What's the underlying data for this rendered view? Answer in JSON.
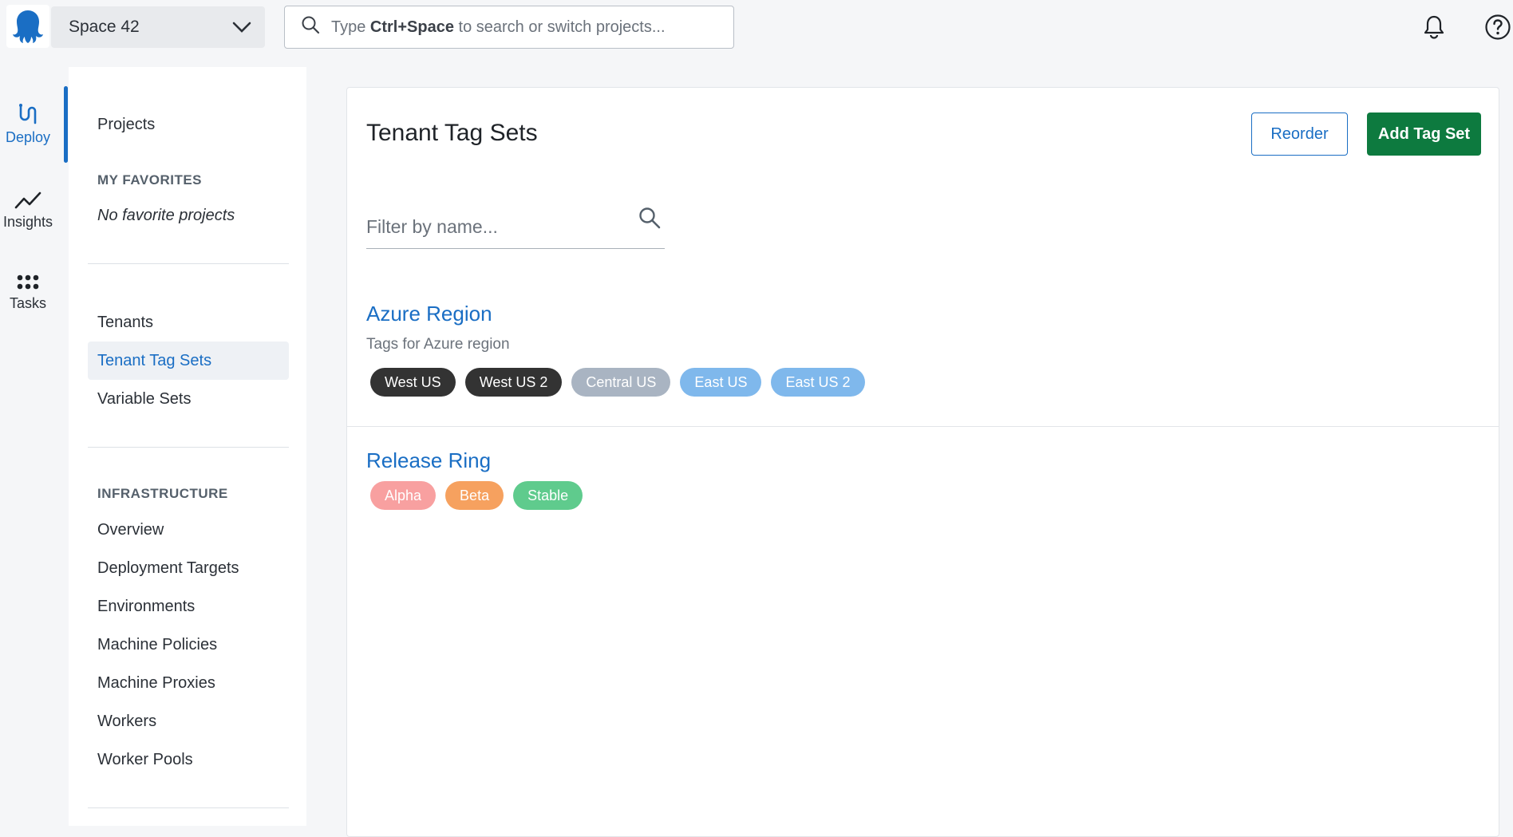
{
  "header": {
    "space_name": "Space 42",
    "search_prefix": "Type ",
    "search_shortcut": "Ctrl+Space",
    "search_suffix": " to search or switch projects..."
  },
  "rail": {
    "items": [
      {
        "label": "Deploy",
        "icon": "deploy-icon"
      },
      {
        "label": "Insights",
        "icon": "trend-icon"
      },
      {
        "label": "Tasks",
        "icon": "dots-grid-icon"
      }
    ]
  },
  "sidenav": {
    "projects": "Projects",
    "favorites_header": "MY FAVORITES",
    "favorites_empty": "No favorite projects",
    "library": [
      "Tenants",
      "Tenant Tag Sets",
      "Variable Sets"
    ],
    "infrastructure_header": "INFRASTRUCTURE",
    "infrastructure": [
      "Overview",
      "Deployment Targets",
      "Environments",
      "Machine Policies",
      "Machine Proxies",
      "Workers",
      "Worker Pools"
    ]
  },
  "main": {
    "title": "Tenant Tag Sets",
    "reorder_label": "Reorder",
    "add_label": "Add Tag Set",
    "filter_placeholder": "Filter by name...",
    "tag_sets": [
      {
        "name": "Azure Region",
        "description": "Tags for Azure region",
        "tags": [
          {
            "label": "West US",
            "color": "#333333"
          },
          {
            "label": "West US 2",
            "color": "#333333"
          },
          {
            "label": "Central US",
            "color": "#a9b4c2"
          },
          {
            "label": "East US",
            "color": "#7fb8ec"
          },
          {
            "label": "East US 2",
            "color": "#7fb8ec"
          }
        ]
      },
      {
        "name": "Release Ring",
        "description": "",
        "tags": [
          {
            "label": "Alpha",
            "color": "#f8a0a0"
          },
          {
            "label": "Beta",
            "color": "#f6a15f"
          },
          {
            "label": "Stable",
            "color": "#5fcb8d"
          }
        ]
      }
    ]
  },
  "colors": {
    "accent": "#1a6ec4",
    "primary_button": "#0d7a3f"
  }
}
